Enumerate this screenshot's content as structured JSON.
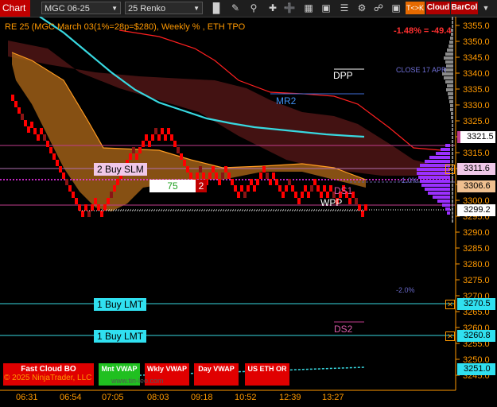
{
  "toolbar": {
    "chart_tab": "Chart",
    "instrument": "MGC 06-25",
    "bar_type": "25 Renko",
    "tk_label": "T<>K",
    "cloud_label": "Cloud",
    "barcol_label": "BarCol"
  },
  "header": {
    "title": "RE 25 (MGC March 03(1%=28p=$280), Weekly % , ETH TPO",
    "change": "-1.48% = -49.4"
  },
  "levels": {
    "dpp": "DPP",
    "mr2": "MR2",
    "close": "CLOSE 17 APR",
    "pct_neg1": "-1.0%",
    "ds1": "DS1",
    "wpp": "WPP",
    "pct_neg2": "-2.0%",
    "ds2": "DS2"
  },
  "orders": {
    "buy_slm": "2 Buy SLM",
    "count_box": "75",
    "count_red": "2",
    "buy_lmt_1": "1 Buy LMT",
    "buy_lmt_2": "1 Buy LMT"
  },
  "price_axis": {
    "ticks": [
      "3355.0",
      "3350.0",
      "3345.0",
      "3340.0",
      "3335.0",
      "3330.0",
      "3325.0",
      "3320.0",
      "3315.0",
      "3310.0",
      "3305.0",
      "3300.0",
      "3295.0",
      "3290.0",
      "3285.0",
      "3280.0",
      "3275.0",
      "3270.0",
      "3265.0",
      "3260.0",
      "3255.0",
      "3250.0",
      "3245.0"
    ],
    "badge_3321": "3321.5",
    "badge_3311": "3311.6",
    "badge_3306": "3306.6",
    "badge_3299": "3299.2",
    "badge_3270": "3270.5",
    "badge_3260": "3260.8",
    "badge_3251": "3251.0"
  },
  "time_axis": [
    "06:31",
    "06:54",
    "07:05",
    "08:03",
    "09:18",
    "10:52",
    "12:39",
    "13:27"
  ],
  "bottom_buttons": {
    "fast_cloud": "Fast Cloud BO",
    "mnt_vwap": "Mnt VWAP",
    "wkly_vwap": "Wkly VWAP",
    "day_vwap": "Day VWAP",
    "us_eth_or": "US ETH OR"
  },
  "copyright": "© 2025 NinjaTrader, LLC",
  "watermark": "www.tin-leo.com",
  "colors": {
    "accent_red": "#d00000",
    "brick_red": "#ff0000",
    "cyan_line": "#38d8e0",
    "orange_cloud": "#c87a1e",
    "purple_profile": "#9b30ff",
    "axis_orange": "#ff9900"
  }
}
